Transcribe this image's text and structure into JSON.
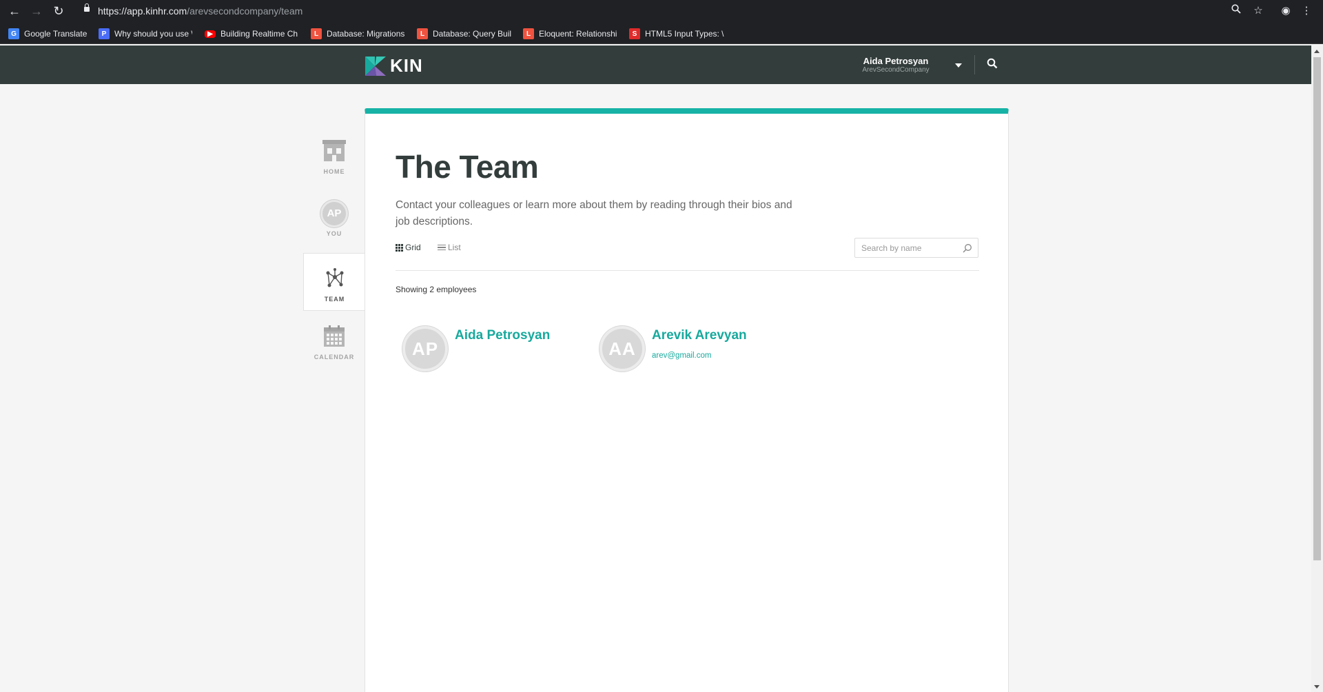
{
  "browser": {
    "url_host": "https://app.kinhr.com",
    "url_path": "/arevsecondcompany/team",
    "bookmarks": [
      {
        "label": "Google Translate",
        "icon": "google-translate-icon",
        "color": "#4285f4"
      },
      {
        "label": "Why should you use \\",
        "icon": "p-icon",
        "color": "#4a6cf7"
      },
      {
        "label": "Building Realtime Ch",
        "icon": "youtube-icon",
        "color": "#ff0000"
      },
      {
        "label": "Database: Migrations",
        "icon": "laravel-icon",
        "color": "#f05340"
      },
      {
        "label": "Database: Query Buil",
        "icon": "laravel-icon",
        "color": "#f05340"
      },
      {
        "label": "Eloquent: Relationshi",
        "icon": "laravel-icon",
        "color": "#f05340"
      },
      {
        "label": "HTML5 Input Types: \\",
        "icon": "s-icon",
        "color": "#e02b2b"
      }
    ]
  },
  "header": {
    "logo_text": "KIN",
    "user_name": "Aida Petrosyan",
    "company": "ArevSecondCompany"
  },
  "sidenav": {
    "home": "HOME",
    "you": "YOU",
    "you_initials": "AP",
    "team": "TEAM",
    "calendar": "CALENDAR"
  },
  "page": {
    "title": "The Team",
    "description": "Contact your colleagues or learn more about them by reading through their bios and job descriptions.",
    "grid_label": "Grid",
    "list_label": "List",
    "search_placeholder": "Search by name",
    "count_text": "Showing 2 employees"
  },
  "employees": [
    {
      "initials": "AP",
      "name": "Aida Petrosyan",
      "email": ""
    },
    {
      "initials": "AA",
      "name": "Arevik Arevyan",
      "email": "arev@gmail.com"
    }
  ],
  "colors": {
    "accent": "#17b3a6",
    "header_bg": "#333d3c"
  }
}
